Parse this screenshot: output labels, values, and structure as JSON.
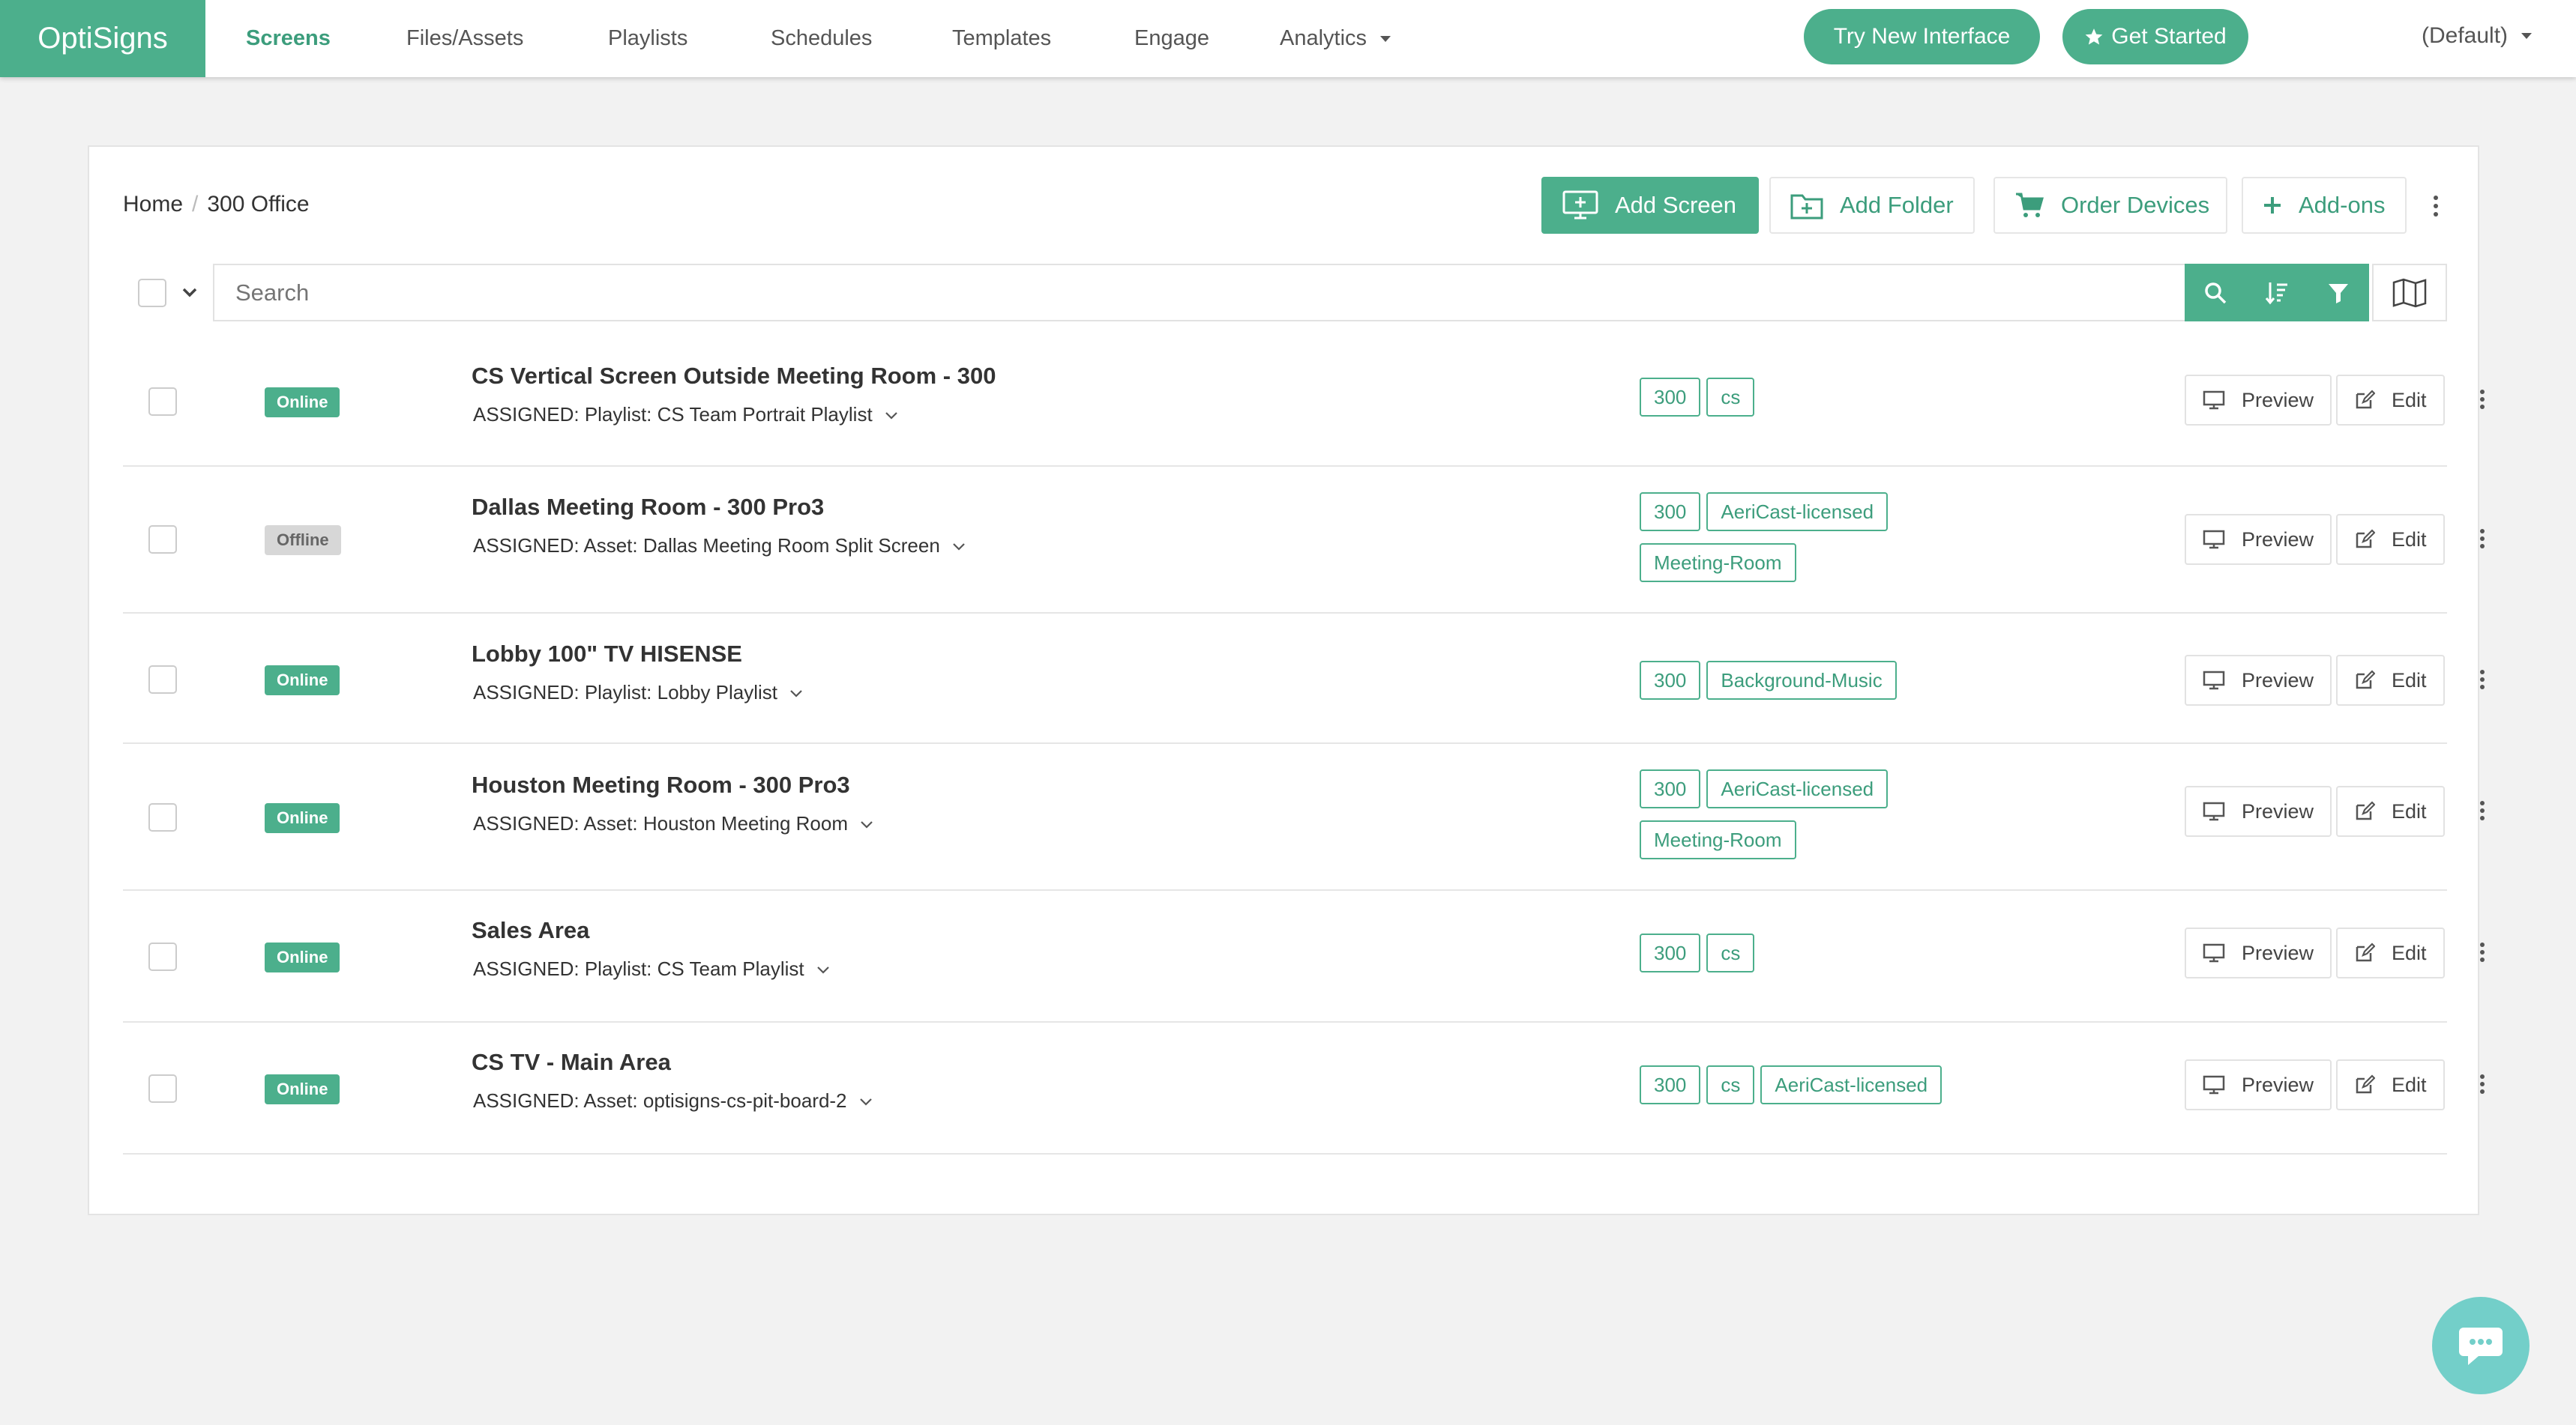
{
  "brand": "OptiSigns",
  "nav": {
    "items": [
      "Screens",
      "Files/Assets",
      "Playlists",
      "Schedules",
      "Templates",
      "Engage"
    ],
    "analytics": "Analytics",
    "try_new": "Try New Interface",
    "get_started": "Get Started",
    "default_label": "(Default)"
  },
  "breadcrumb": {
    "home": "Home",
    "sep": "/",
    "current": "300 Office"
  },
  "toolbar": {
    "add_screen": "Add Screen",
    "add_folder": "Add Folder",
    "order_devices": "Order Devices",
    "addons": "Add-ons"
  },
  "search": {
    "placeholder": "Search"
  },
  "row_buttons": {
    "preview": "Preview",
    "edit": "Edit"
  },
  "colors": {
    "accent": "#4caf8c",
    "accent_text": "#3c9d7c",
    "chat": "#73cfc9"
  },
  "screens": [
    {
      "status": "Online",
      "name": "CS Vertical Screen Outside Meeting Room - 300",
      "assigned": "ASSIGNED: Playlist: CS Team Portrait Playlist",
      "tags": [
        "300",
        "cs"
      ]
    },
    {
      "status": "Offline",
      "name": "Dallas Meeting Room - 300 Pro3",
      "assigned": "ASSIGNED: Asset: Dallas Meeting Room Split Screen",
      "tags": [
        "300",
        "AeriCast-licensed",
        "Meeting-Room"
      ]
    },
    {
      "status": "Online",
      "name": "Lobby 100\" TV HISENSE",
      "assigned": "ASSIGNED: Playlist: Lobby Playlist",
      "tags": [
        "300",
        "Background-Music"
      ]
    },
    {
      "status": "Online",
      "name": "Houston Meeting Room - 300 Pro3",
      "assigned": "ASSIGNED: Asset: Houston Meeting Room",
      "tags": [
        "300",
        "AeriCast-licensed",
        "Meeting-Room"
      ]
    },
    {
      "status": "Online",
      "name": "Sales Area",
      "assigned": "ASSIGNED: Playlist: CS Team Playlist",
      "tags": [
        "300",
        "cs"
      ]
    },
    {
      "status": "Online",
      "name": "CS TV - Main Area",
      "assigned": "ASSIGNED: Asset: optisigns-cs-pit-board-2",
      "tags": [
        "300",
        "cs",
        "AeriCast-licensed"
      ]
    }
  ]
}
